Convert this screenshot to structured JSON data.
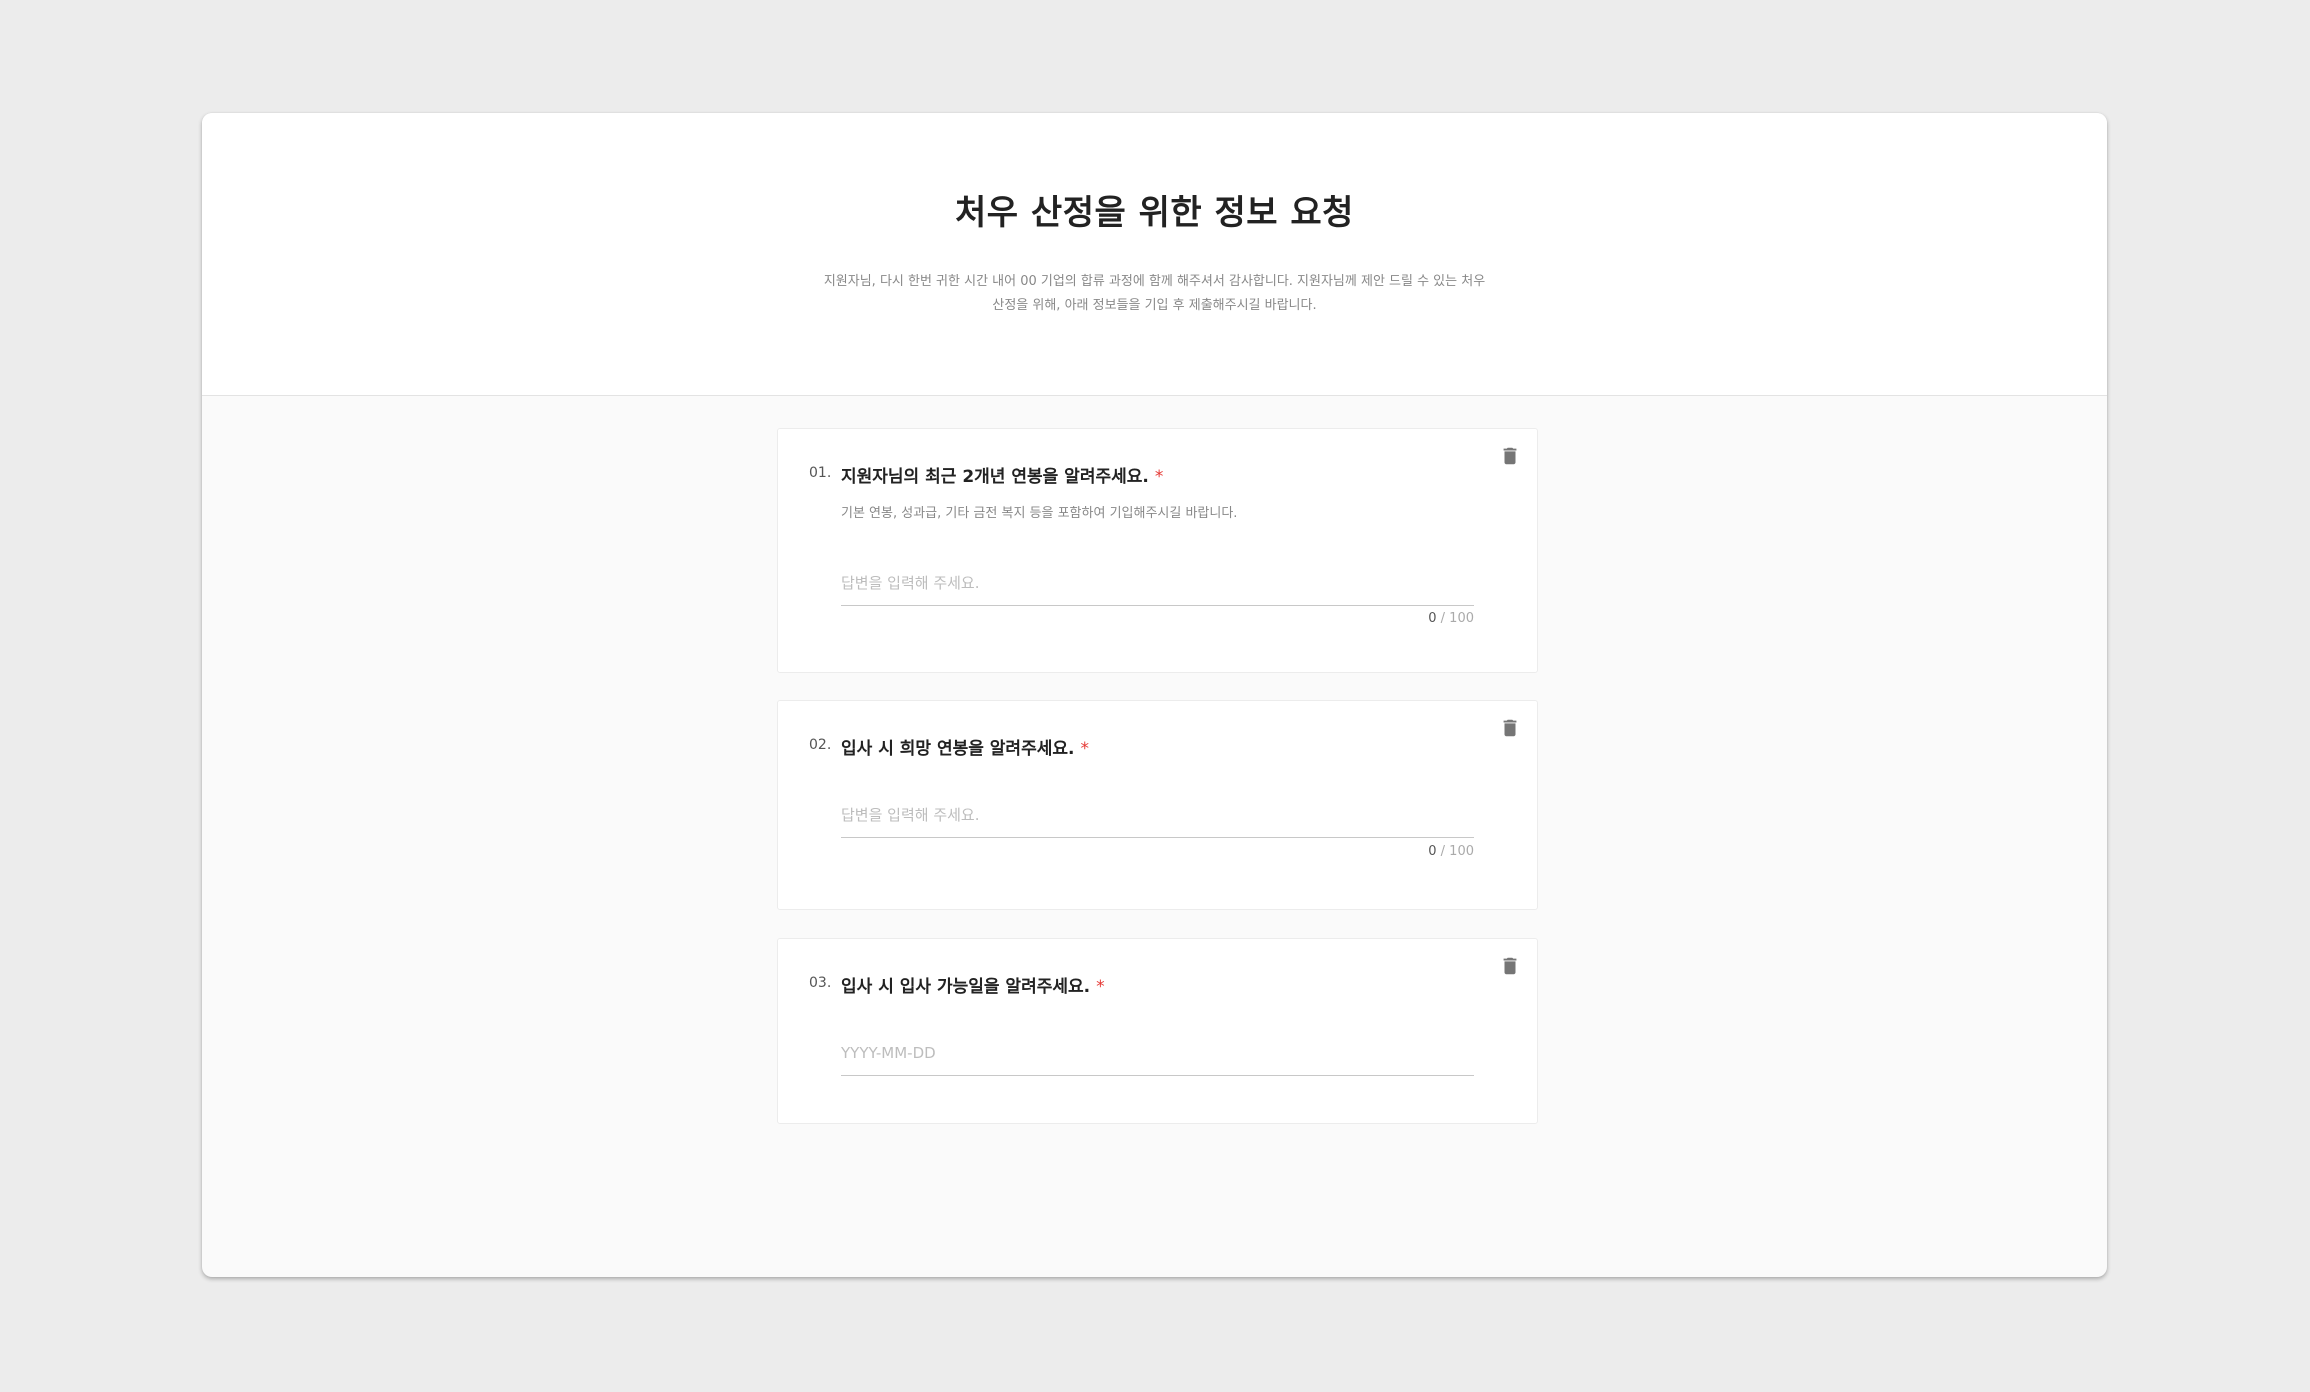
{
  "header": {
    "title": "처우 산정을 위한 정보 요청",
    "subtitle": "지원자님, 다시 한번 귀한 시간 내어 00 기업의 합류 과정에 함께 해주셔서 감사합니다. 지원자님께 제안 드릴 수 있는 처우 산정을 위해, 아래 정보들을 기입 후 제출해주시길 바랍니다."
  },
  "questions": [
    {
      "number": "01.",
      "title": "지원자님의 최근 2개년 연봉을 알려주세요.",
      "required_mark": "*",
      "description": "기본 연봉, 성과급, 기타 금전 복지 등을 포함하여 기입해주시길 바랍니다.",
      "placeholder": "답변을 입력해 주세요.",
      "value": "",
      "count_current": "0",
      "count_max": "/ 100",
      "icon": "trash-icon"
    },
    {
      "number": "02.",
      "title": "입사 시 희망 연봉을 알려주세요.",
      "required_mark": "*",
      "placeholder": "답변을 입력해 주세요.",
      "value": "",
      "count_current": "0",
      "count_max": "/ 100",
      "icon": "trash-icon"
    },
    {
      "number": "03.",
      "title": "입사 시 입사 가능일을 알려주세요.",
      "required_mark": "*",
      "placeholder": "YYYY-MM-DD",
      "value": "",
      "icon": "trash-icon"
    }
  ],
  "colors": {
    "background": "#ececec",
    "card": "#ffffff",
    "required": "#e53935",
    "text": "#222222",
    "muted": "#888888"
  }
}
